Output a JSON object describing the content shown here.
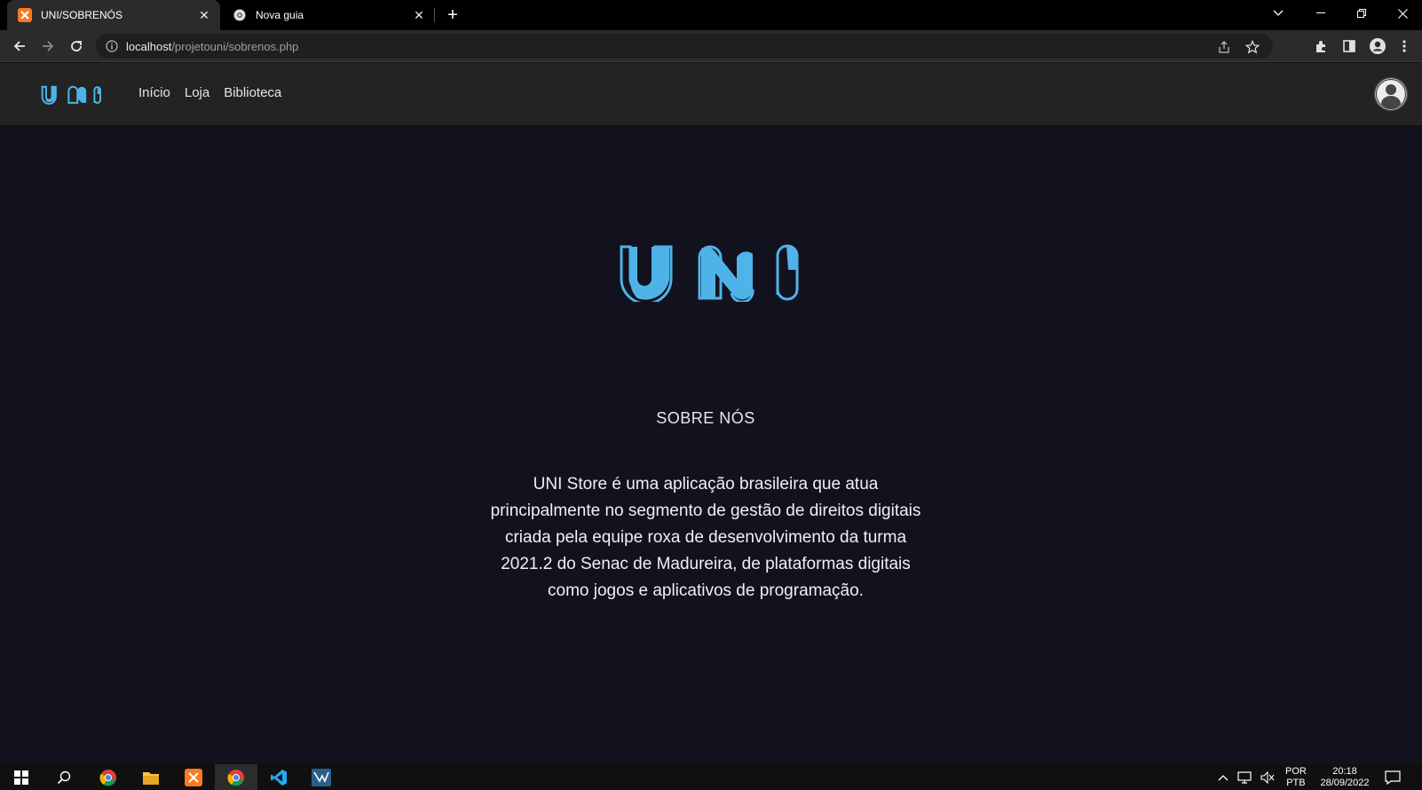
{
  "browser": {
    "tabs": [
      {
        "title": "UNI/SOBRENÓS",
        "active": true
      },
      {
        "title": "Nova guia",
        "active": false
      }
    ],
    "address": {
      "host": "localhost",
      "path": "/projetouni/sobrenos.php"
    }
  },
  "site": {
    "brand": "UNI",
    "nav": [
      {
        "label": "Início"
      },
      {
        "label": "Loja"
      },
      {
        "label": "Biblioteca"
      }
    ],
    "about": {
      "title": "SOBRE NÓS",
      "text": "UNI Store é uma aplicação brasileira que atua principalmente no segmento de gestão de direitos digitais criada pela equipe roxa de desenvolvimento da turma 2021.2 do Senac de Madureira, de plataformas digitais como jogos e aplicativos de programação."
    }
  },
  "taskbar": {
    "language": {
      "line1": "POR",
      "line2": "PTB"
    },
    "time": "20:18",
    "date": "28/09/2022"
  },
  "colors": {
    "brand_blue": "#4fb3e8",
    "page_bg": "#12121f",
    "navbar_bg": "#232323"
  }
}
